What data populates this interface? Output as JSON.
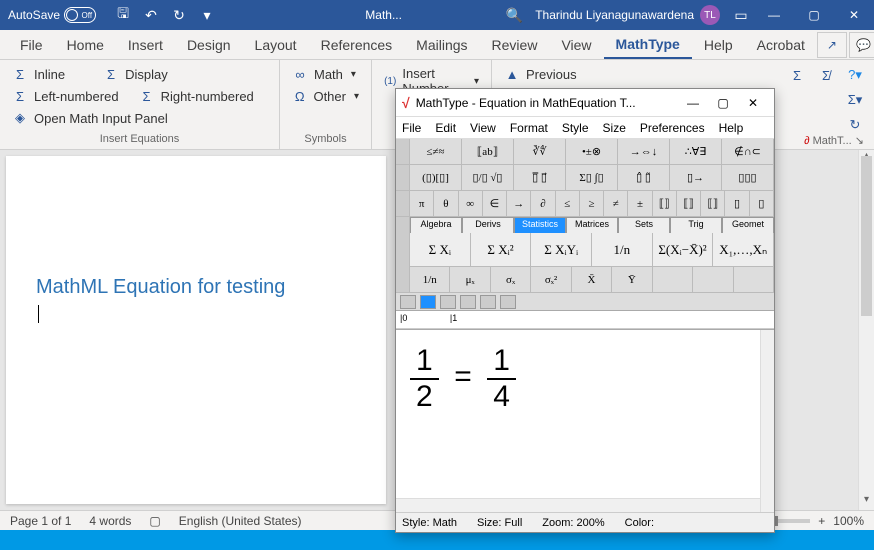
{
  "titlebar": {
    "autosave_label": "AutoSave",
    "autosave_state": "Off",
    "doc_title": "Math...",
    "user_name": "Tharindu Liyanagunawardena",
    "user_initials": "TL"
  },
  "tabs": [
    "File",
    "Home",
    "Insert",
    "Design",
    "Layout",
    "References",
    "Mailings",
    "Review",
    "View",
    "MathType",
    "Help",
    "Acrobat"
  ],
  "active_tab": "MathType",
  "ribbon": {
    "insert_eq": {
      "inline": "Inline",
      "display": "Display",
      "left_num": "Left-numbered",
      "right_num": "Right-numbered",
      "open_panel": "Open Math Input Panel",
      "group_label": "Insert Equations"
    },
    "symbols": {
      "math": "Math",
      "other": "Other",
      "group_label": "Symbols"
    },
    "insert_num": "Insert Number",
    "previous": "Previous",
    "mathtype_badge": "MathT..."
  },
  "document": {
    "heading": "MathML Equation for testing"
  },
  "statusbar": {
    "page": "Page 1 of 1",
    "words": "4 words",
    "lang": "English (United States)",
    "zoom": "100%"
  },
  "mathtype": {
    "title": "MathType - Equation in MathEquation T...",
    "menus": [
      "File",
      "Edit",
      "View",
      "Format",
      "Style",
      "Size",
      "Preferences",
      "Help"
    ],
    "palette_tabs": [
      "Algebra",
      "Derivs",
      "Statistics",
      "Matrices",
      "Sets",
      "Trig",
      "Geomet"
    ],
    "active_palette": "Statistics",
    "row1": [
      "≤≠≈",
      "⟦ab⟧",
      "∛∜",
      "•±⊗",
      "→⇔↓",
      "∴∀∃",
      "∉∩⊂"
    ],
    "row2": [
      "(▯)[▯]",
      "▯/▯ √▯",
      "▯̅ ▯⃗",
      "Σ▯ ∫▯",
      "▯̂ ▯̃",
      "▯→",
      "▯▯▯"
    ],
    "row3": [
      "π",
      "θ",
      "∞",
      "∈",
      "→",
      "∂",
      "≤",
      "≥",
      "≠",
      "±",
      "⟦⟧",
      "⟦⟧",
      "⟦⟧",
      "▯",
      "▯"
    ],
    "big1": [
      "Σ Xᵢ",
      "Σ Xᵢ²",
      "Σ XᵢYᵢ",
      "1/n",
      "Σ(Xᵢ−X̄)²",
      "X₁,…,Xₙ"
    ],
    "big2": [
      "1/n",
      "μₓ",
      "σₓ",
      "σₓ²",
      "X̄",
      "Ȳ"
    ],
    "equation": {
      "lhs_num": "1",
      "lhs_den": "2",
      "rhs_num": "1",
      "rhs_den": "4"
    },
    "status": {
      "style": "Style: Math",
      "size": "Size: Full",
      "zoom": "Zoom: 200%",
      "color": "Color:"
    }
  }
}
